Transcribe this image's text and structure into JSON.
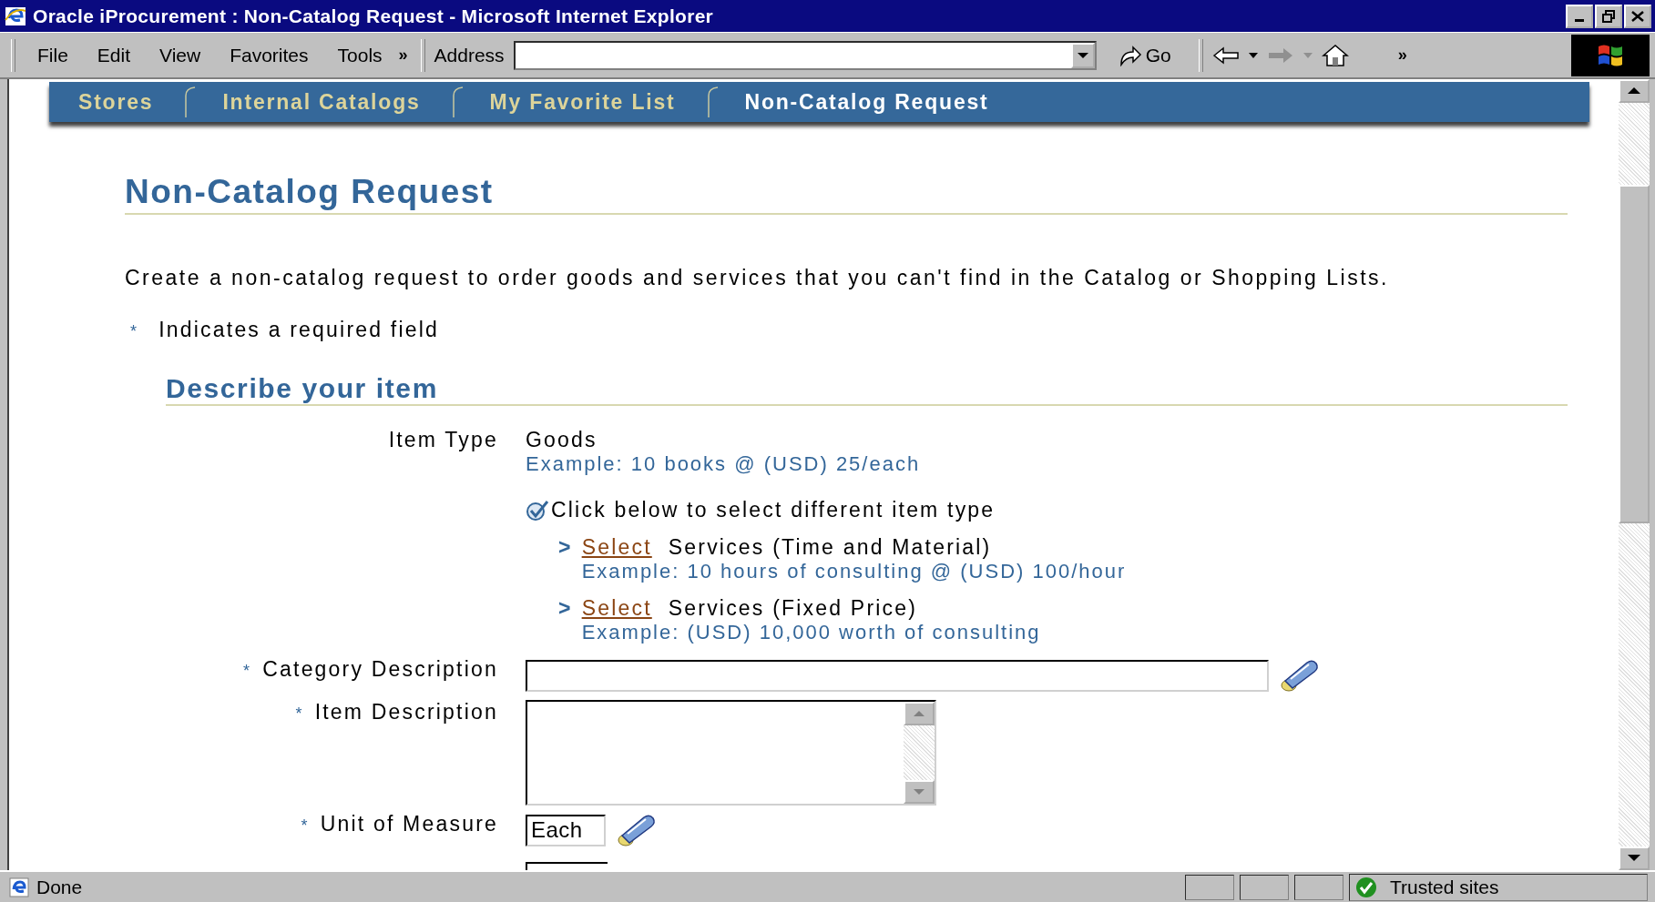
{
  "window": {
    "title": "Oracle iProcurement : Non-Catalog Request - Microsoft Internet Explorer"
  },
  "menu": [
    {
      "label": "File"
    },
    {
      "label": "Edit"
    },
    {
      "label": "View"
    },
    {
      "label": "Favorites"
    },
    {
      "label": "Tools"
    }
  ],
  "menu_more": "»",
  "address": {
    "label": "Address"
  },
  "go_button": "Go",
  "toolbar_more": "»",
  "tabs": [
    {
      "label": "Stores",
      "selected": false
    },
    {
      "label": "Internal Catalogs",
      "selected": false
    },
    {
      "label": "My Favorite List",
      "selected": false
    },
    {
      "label": "Non-Catalog Request",
      "selected": true
    }
  ],
  "page": {
    "heading": "Non-Catalog Request",
    "intro": "Create a non-catalog request to order goods and services that you can't find in the Catalog or Shopping Lists.",
    "required_note": {
      "marker": "*",
      "text": "Indicates a required field"
    },
    "section": "Describe your item",
    "item_type": {
      "label": "Item Type",
      "value": "Goods",
      "example": "Example: 10 books @ (USD) 25/each",
      "prompt": "Click below to select different item type"
    },
    "options": [
      {
        "marker": ">",
        "link": "Select",
        "label": "Services (Time and Material)",
        "example": "Example: 10 hours of consulting @ (USD) 100/hour"
      },
      {
        "marker": ">",
        "link": "Select",
        "label": "Services (Fixed Price)",
        "example": "Example: (USD) 10,000 worth of consulting"
      }
    ],
    "fields": [
      {
        "kind": "lookup",
        "marker": "*",
        "label": "Category Description"
      },
      {
        "kind": "textarea",
        "marker": "*",
        "label": "Item Description"
      },
      {
        "kind": "code",
        "marker": "*",
        "label": "Unit of Measure",
        "value": "Each"
      },
      {
        "kind": "partial"
      }
    ]
  },
  "status_bar": {
    "text": "Done",
    "zone": "Trusted sites"
  }
}
